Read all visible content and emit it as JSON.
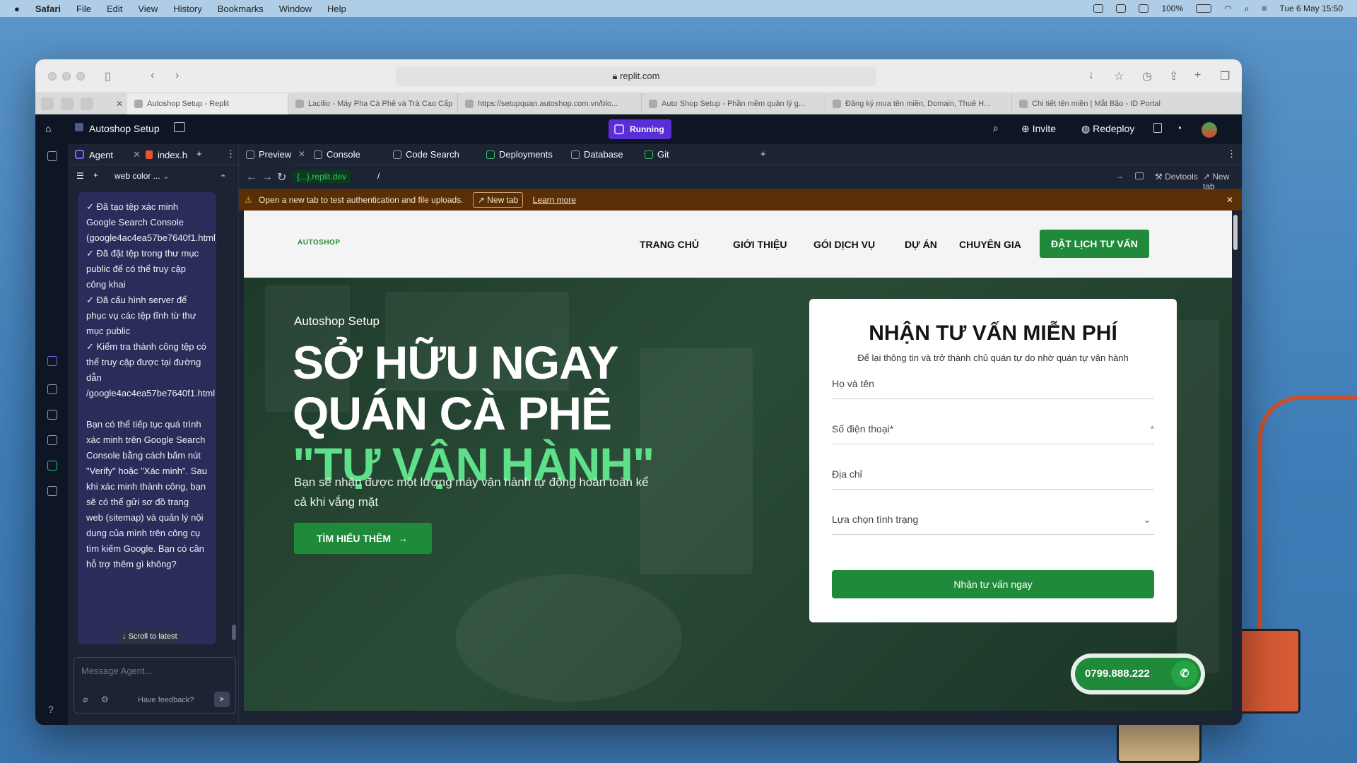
{
  "menubar": {
    "app": "Safari",
    "items": [
      "File",
      "Edit",
      "View",
      "History",
      "Bookmarks",
      "Window",
      "Help"
    ],
    "battery": "100%",
    "clock": "Tue 6 May  15:50"
  },
  "safari": {
    "url": "replit.com",
    "tabs": [
      {
        "label": "Autoshop Setup - Replit"
      },
      {
        "label": "Lacilio - Máy Pha Cà Phê và Trà Cao Cấp"
      },
      {
        "label": "https://setupquan.autoshop.com.vn/blo..."
      },
      {
        "label": "Auto Shop Setup - Phần mềm quản lý g..."
      },
      {
        "label": "Đăng ký mua tên miền, Domain, Thuê H..."
      },
      {
        "label": "Chi tiết tên miền | Mắt Bão - ID Portal"
      }
    ]
  },
  "replit": {
    "project_name": "Autoshop Setup",
    "status": "Running",
    "invite": "Invite",
    "redeploy": "Redeploy",
    "agent_tabs": {
      "agent": "Agent",
      "file": "index.h"
    },
    "thread_title": "web color ...",
    "chat_message": "✓ Đã tạo tệp xác minh Google Search Console (google4ac4ea57be7640f1.html)\n✓ Đã đặt tệp trong thư mục public để có thể truy cập công khai\n✓ Đã cấu hình server để phục vụ các tệp tĩnh từ thư mục public\n✓ Kiểm tra thành công tệp có thể truy cập được tại đường dẫn /google4ac4ea57be7640f1.html\n\nBạn có thể tiếp tục quá trình xác minh trên Google Search Console bằng cách bấm nút \"Verify\" hoặc \"Xác minh\". Sau khi xác minh thành công, bạn sẽ có thể gửi sơ đồ trang web (sitemap) và quản lý nội dung của mình trên công cụ tìm kiếm Google. Bạn có cần hỗ trợ thêm gì không?",
    "scroll_latest": "Scroll to latest",
    "message_placeholder": "Message Agent...",
    "feedback": "Have feedback?",
    "pane_tabs": [
      "Preview",
      "Console",
      "Code Search",
      "Deployments",
      "Database",
      "Git"
    ],
    "dev_url": "{...}.replit.dev",
    "path": "/",
    "devtools": "Devtools",
    "new_tab": "New tab",
    "warning": "Open a new tab to test authentication and file uploads.",
    "warning_button": "New tab",
    "learn_more": "Learn more"
  },
  "site": {
    "logo": "AUTOSHOP",
    "nav": [
      "TRANG CHỦ",
      "GIỚI THIỆU",
      "GÓI DỊCH VỤ",
      "DỰ ÁN",
      "CHUYÊN GIA"
    ],
    "cta": "ĐẶT LỊCH TƯ VẤN",
    "hero_eyebrow": "Autoshop Setup",
    "hero_line1": "SỞ HỮU NGAY",
    "hero_line2": "QUÁN CÀ PHÊ",
    "hero_line3": "\"TỰ VẬN HÀNH\"",
    "hero_desc": "Bạn sẽ nhận được một lượng máy vận hành tự động hoàn toàn kể cả khi vắng mặt",
    "hero_button": "TÌM HIỂU THÊM",
    "form_title": "NHẬN TƯ VẤN MIỄN PHÍ",
    "form_subtitle": "Để lại thông tin và trở thành chủ quán tự do nhờ quán tự vận hành",
    "field_name": "Họ và tên",
    "field_phone": "Số điện thoại*",
    "field_address": "Địa chỉ",
    "field_status": "Lựa chọn tình trạng",
    "submit": "Nhận tư vấn ngay",
    "hotline": "0799.888.222"
  },
  "colors": {
    "accent_green": "#1f8a3a",
    "hero_highlight": "#5ee08a",
    "replit_bg": "#0e1525",
    "running_purple": "#5a2ed6"
  }
}
